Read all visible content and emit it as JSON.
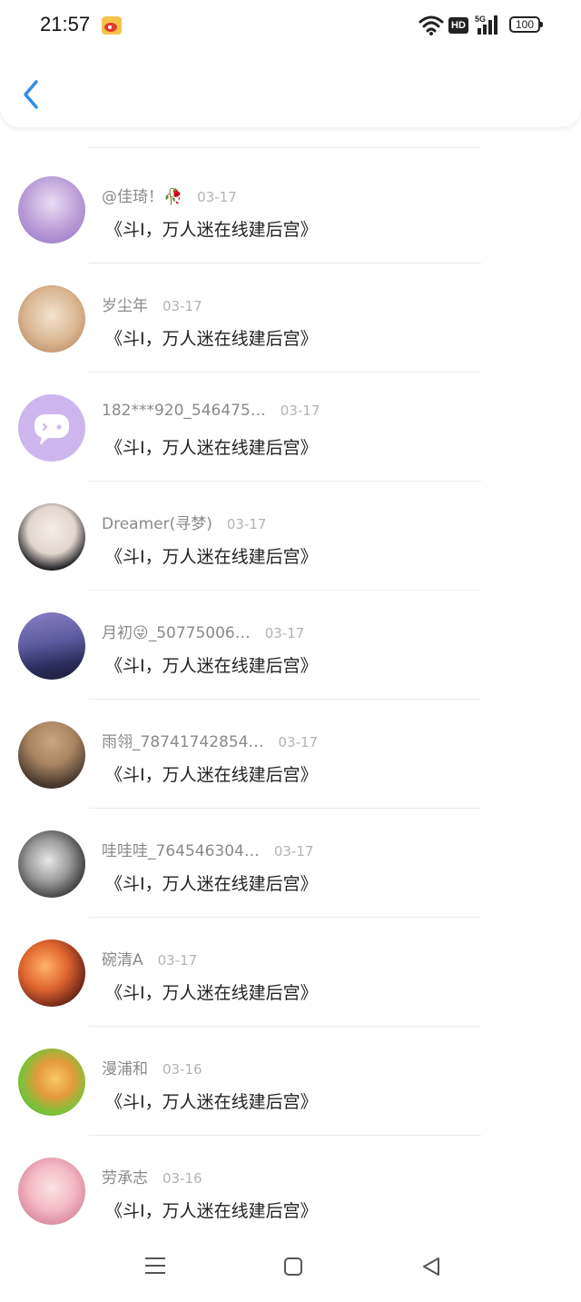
{
  "status_bar": {
    "time": "21:57",
    "network": "5G",
    "hd": "HD",
    "battery": "100"
  },
  "header": {
    "back_icon": "chevron-left-icon",
    "accent_color": "#2f8ee8"
  },
  "comment_text": "《斗I，万人迷在线建后宫》",
  "rows": [
    {
      "username": "@佳琦！🥀",
      "date": "03-17"
    },
    {
      "username": "岁尘年",
      "date": "03-17"
    },
    {
      "username": "182***920_546475…",
      "date": "03-17"
    },
    {
      "username": "Dreamer(寻梦)",
      "date": "03-17"
    },
    {
      "username": "月初😜_50775006…",
      "date": "03-17"
    },
    {
      "username": "雨翎_78741742854…",
      "date": "03-17"
    },
    {
      "username": "哇哇哇_764546304…",
      "date": "03-17"
    },
    {
      "username": "碗清A",
      "date": "03-17"
    },
    {
      "username": "漫浦和",
      "date": "03-16"
    },
    {
      "username": "劳承志",
      "date": "03-16"
    }
  ],
  "nav": {
    "menu_icon": "menu-icon",
    "home_icon": "home-square-icon",
    "back_icon": "back-triangle-icon"
  }
}
